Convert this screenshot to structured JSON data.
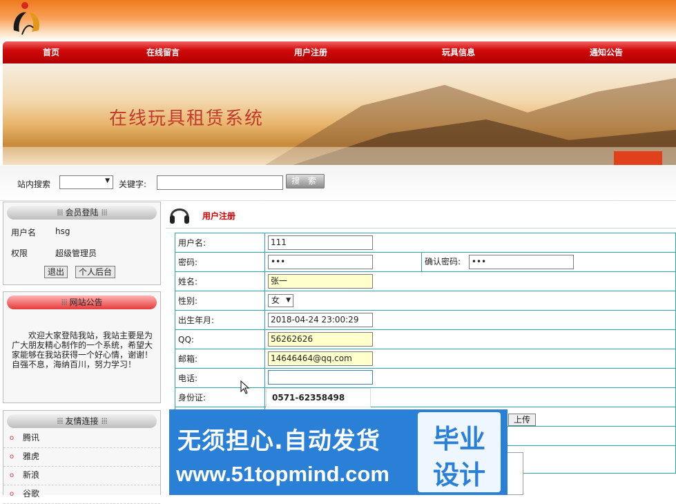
{
  "nav": {
    "items": [
      {
        "label": "首页"
      },
      {
        "label": "在线留言"
      },
      {
        "label": "用户注册"
      },
      {
        "label": "玩具信息"
      },
      {
        "label": "通知公告"
      }
    ]
  },
  "banner": {
    "title": "在线玩具租赁系统"
  },
  "search": {
    "site_search_label": "站内搜索",
    "keyword_label": "关键字:",
    "button_label": "搜 索",
    "select_value": ""
  },
  "member": {
    "title": "会员登陆",
    "username_label": "用户名",
    "username_value": "hsg",
    "role_label": "权限",
    "role_value": "超级管理员",
    "logout_label": "退出",
    "backend_label": "个人后台"
  },
  "notice": {
    "title": "网站公告",
    "text": "欢迎大家登陆我站，我站主要是为广大朋友精心制作的一个系统，希望大家能够在我站获得一个好心情，谢谢！　　自强不息，海纳百川，努力学习！"
  },
  "links": {
    "title": "友情连接",
    "items": [
      {
        "label": "腾讯"
      },
      {
        "label": "雅虎"
      },
      {
        "label": "新浪"
      },
      {
        "label": "谷歌"
      }
    ]
  },
  "content": {
    "title": "用户注册"
  },
  "form": {
    "username_label": "用户名:",
    "username_value": "111",
    "password_label": "密码:",
    "password_value": "•••",
    "confirm_label": "确认密码:",
    "confirm_value": "•••",
    "name_label": "姓名:",
    "name_value": "张一",
    "sex_label": "性别:",
    "sex_value": "女",
    "birth_label": "出生年月:",
    "birth_value": "2018-04-24 23:00:29",
    "qq_label": "QQ:",
    "qq_value": "56262626",
    "email_label": "邮箱:",
    "email_value": "14646464@qq.com",
    "phone_label": "电话:",
    "phone_value": "",
    "phone_suggestion": "0571-62358498",
    "idcard_label": "身份证:",
    "upload_label": "上传"
  },
  "watermark": {
    "main": "无须担心.自动发货",
    "url": "www.51topmind.com",
    "box_line1": "毕业",
    "box_line2": "设计"
  },
  "colors": {
    "accent_red": "#c00000",
    "table_border": "#2fa6a6",
    "watermark_blue": "#2a7fd6"
  }
}
